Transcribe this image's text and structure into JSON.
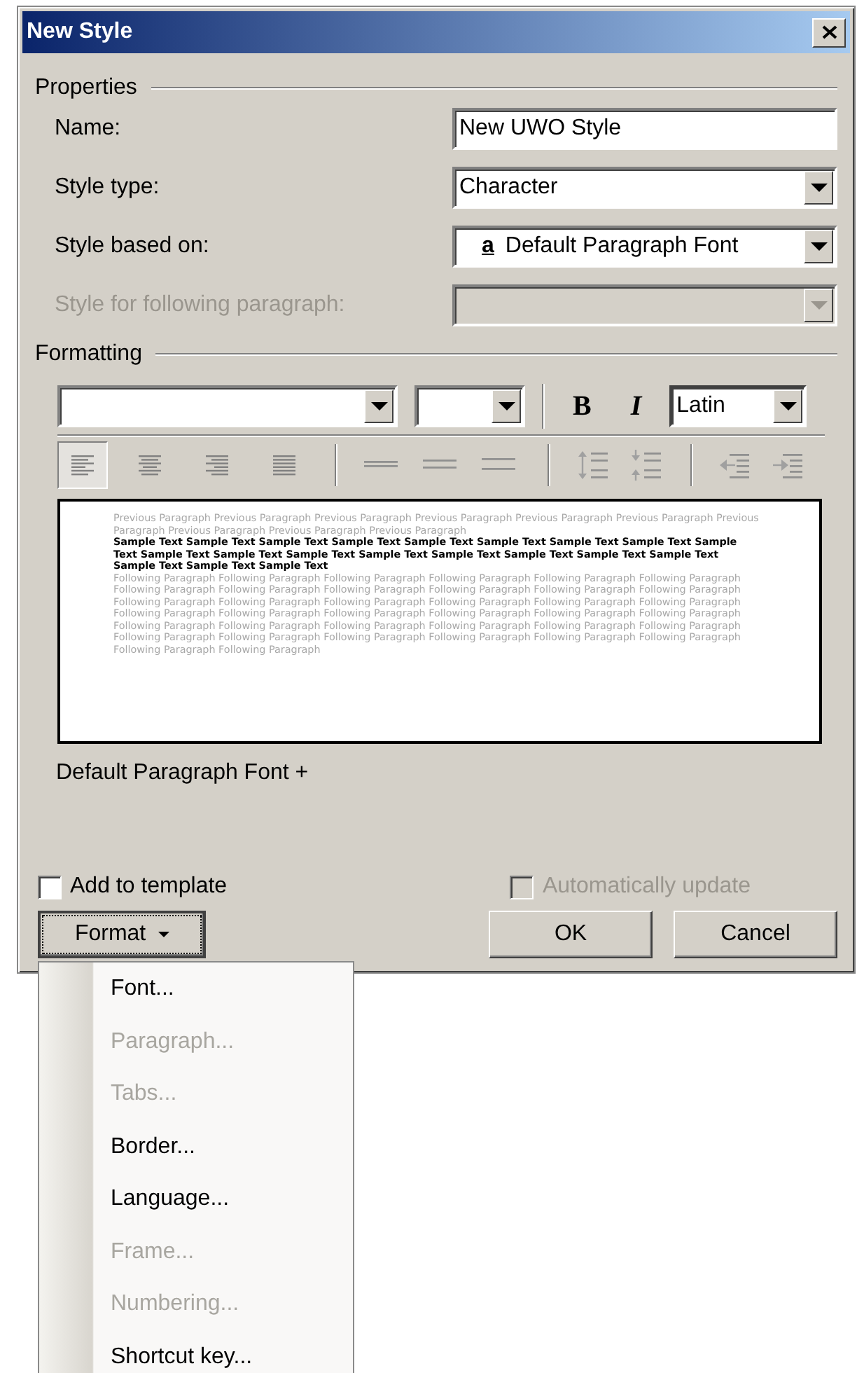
{
  "window": {
    "title": "New Style"
  },
  "properties": {
    "heading": "Properties",
    "fields": [
      {
        "kind": "text",
        "label": "Name:",
        "value": "New UWO Style",
        "disabled": false
      },
      {
        "kind": "combo",
        "label": "Style type:",
        "value": "Character",
        "disabled": false
      },
      {
        "kind": "combo",
        "label": "Style based on:",
        "value": "Default Paragraph Font",
        "glyph": "a",
        "disabled": false
      },
      {
        "kind": "combo",
        "label": "Style for following paragraph:",
        "disabled": true
      }
    ]
  },
  "formatting": {
    "heading": "Formatting",
    "bold_label": "B",
    "italic_label": "I",
    "script": "Latin",
    "alignment": [
      {
        "selected": true
      },
      {
        "selected": false
      },
      {
        "selected": false
      },
      {
        "selected": false
      }
    ],
    "preview": {
      "previous": "Previous Paragraph Previous Paragraph Previous Paragraph Previous Paragraph Previous Paragraph Previous Paragraph Previous Paragraph Previous Paragraph Previous Paragraph Previous Paragraph",
      "sample": "Sample Text Sample Text Sample Text Sample Text Sample Text Sample Text Sample Text Sample Text Sample Text Sample Text Sample Text Sample Text Sample Text Sample Text Sample Text Sample Text Sample Text Sample Text Sample Text Sample Text",
      "following": "Following Paragraph Following Paragraph Following Paragraph Following Paragraph Following Paragraph Following Paragraph Following Paragraph Following Paragraph Following Paragraph Following Paragraph Following Paragraph Following Paragraph Following Paragraph Following Paragraph Following Paragraph Following Paragraph Following Paragraph Following Paragraph Following Paragraph Following Paragraph Following Paragraph Following Paragraph Following Paragraph Following Paragraph Following Paragraph Following Paragraph Following Paragraph Following Paragraph Following Paragraph Following Paragraph Following Paragraph Following Paragraph Following Paragraph Following Paragraph Following Paragraph Following Paragraph Following Paragraph Following Paragraph"
    },
    "description": "Default Paragraph Font +"
  },
  "options": [
    {
      "label": "Add to template",
      "checked": false,
      "disabled": false
    },
    {
      "label": "Automatically update",
      "checked": false,
      "disabled": true
    }
  ],
  "buttons": {
    "format": "Format",
    "ok": "OK",
    "cancel": "Cancel"
  },
  "format_menu": [
    {
      "label": "Font...",
      "disabled": false
    },
    {
      "label": "Paragraph...",
      "disabled": true
    },
    {
      "label": "Tabs...",
      "disabled": true
    },
    {
      "label": "Border...",
      "disabled": false
    },
    {
      "label": "Language...",
      "disabled": false
    },
    {
      "label": "Frame...",
      "disabled": true
    },
    {
      "label": "Numbering...",
      "disabled": true
    },
    {
      "label": "Shortcut key...",
      "disabled": false
    }
  ]
}
